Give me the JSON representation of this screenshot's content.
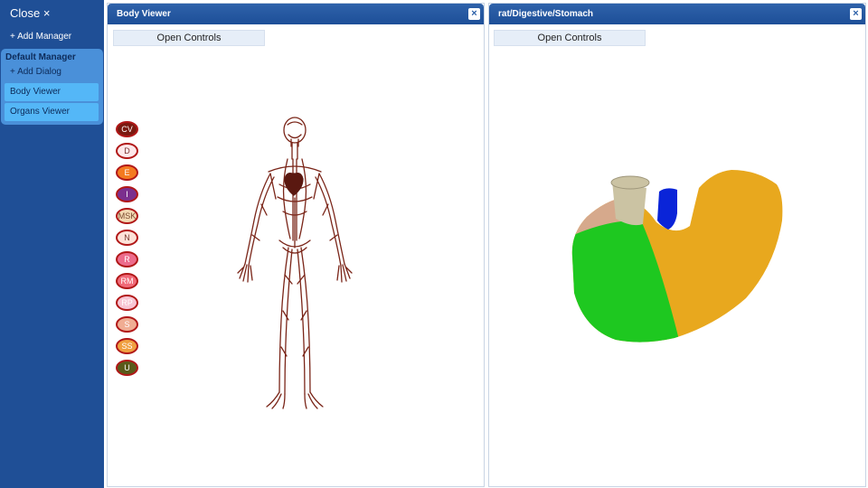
{
  "sidebar": {
    "close_label": "Close ×",
    "add_manager_label": "+ Add Manager",
    "manager": {
      "title": "Default Manager",
      "add_dialog_label": "+ Add Dialog",
      "items": [
        {
          "label": "Body Viewer"
        },
        {
          "label": "Organs Viewer"
        }
      ]
    }
  },
  "body_viewer": {
    "title": "Body Viewer",
    "open_controls_label": "Open Controls",
    "systems": [
      {
        "label": "CV",
        "color": "#7a1a10",
        "text_color": "#ffffff"
      },
      {
        "label": "D",
        "color": "#fde8ea",
        "text_color": "#7a3030"
      },
      {
        "label": "E",
        "color": "#f47a20",
        "text_color": "#ffffff"
      },
      {
        "label": "I",
        "color": "#7b2f8e",
        "text_color": "#ffffff"
      },
      {
        "label": "MSK",
        "color": "#f3d9b3",
        "text_color": "#7a4a30"
      },
      {
        "label": "N",
        "color": "#fde2d8",
        "text_color": "#7a3a30"
      },
      {
        "label": "R",
        "color": "#ec6c8c",
        "text_color": "#ffffff"
      },
      {
        "label": "RM",
        "color": "#f06a78",
        "text_color": "#ffffff"
      },
      {
        "label": "RP",
        "color": "#f8c6d4",
        "text_color": "#ffffff"
      },
      {
        "label": "S",
        "color": "#f0ad93",
        "text_color": "#ffffff"
      },
      {
        "label": "SS",
        "color": "#f0a040",
        "text_color": "#ffffff"
      },
      {
        "label": "U",
        "color": "#5a5a1a",
        "text_color": "#ffffff"
      }
    ],
    "figure_color": "#7a2518"
  },
  "organ_viewer": {
    "title": "rat/Digestive/Stomach",
    "open_controls_label": "Open Controls",
    "colors": {
      "body": "#e8a81e",
      "green": "#1ec820",
      "tan": "#d6a98c",
      "tube": "#cbc3a3",
      "blue": "#0a24d8"
    }
  }
}
